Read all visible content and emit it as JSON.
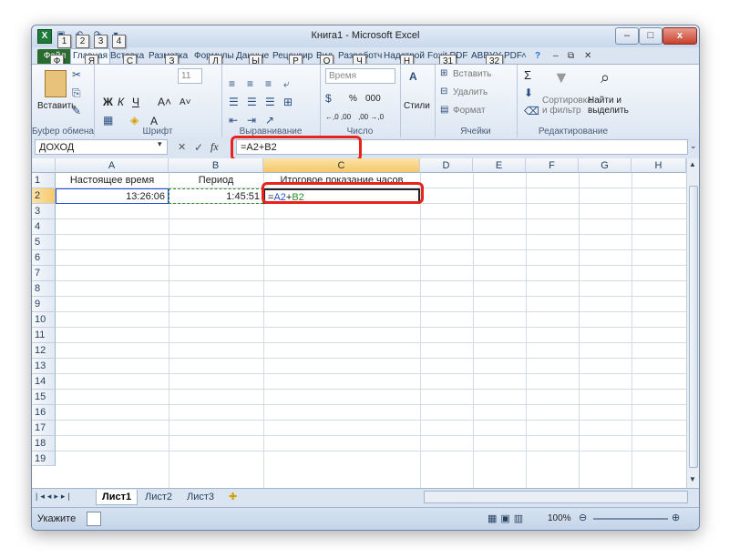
{
  "window": {
    "title": "Книга1 - Microsoft Excel",
    "app_icon": "X",
    "controls": {
      "minimize": "‒",
      "maximize": "□",
      "close": "x"
    }
  },
  "qat_keytips": [
    "1",
    "2",
    "3",
    "4"
  ],
  "tabs": [
    {
      "label": "Файл",
      "keytip": "Ф"
    },
    {
      "label": "Главная",
      "keytip": "Я"
    },
    {
      "label": "Вставка",
      "keytip": "С"
    },
    {
      "label": "Разметка",
      "keytip": "З"
    },
    {
      "label": "Формулы",
      "keytip": "Л"
    },
    {
      "label": "Данные",
      "keytip": "Ы"
    },
    {
      "label": "Рецензир",
      "keytip": "Р"
    },
    {
      "label": "Вид",
      "keytip": "О"
    },
    {
      "label": "Разработч",
      "keytip": "Ч"
    },
    {
      "label": "Надстрой",
      "keytip": "Н"
    },
    {
      "label": "Foxit PDF",
      "keytip": "31"
    },
    {
      "label": "ABBYY PDF",
      "keytip": "32"
    }
  ],
  "ribbon": {
    "clipboard": {
      "paste": "Вставить",
      "label": "Буфер обмена"
    },
    "font": {
      "size": "11",
      "bold": "Ж",
      "italic": "К",
      "underline": "Ч",
      "grow": "A˄",
      "shrink": "A˅",
      "color": "A",
      "label": "Шрифт"
    },
    "alignment": {
      "label": "Выравнивание"
    },
    "number": {
      "format": "Время",
      "percent": "%",
      "thousands": "000",
      "inc": "←,0 ,00",
      "dec": ",00 →,0",
      "label": "Число"
    },
    "styles": {
      "label": "Стили"
    },
    "cells": {
      "insert": "Вставить",
      "delete": "Удалить",
      "format": "Формат",
      "label": "Ячейки"
    },
    "editing": {
      "sum": "Σ",
      "sort": "Сортировка и фильтр",
      "find": "Найти и выделить",
      "label": "Редактирование"
    }
  },
  "formula_bar": {
    "name_box": "ДОХОД",
    "cancel": "✕",
    "enter": "✓",
    "fx": "fx",
    "formula": "=A2+B2"
  },
  "columns": [
    "A",
    "B",
    "C",
    "D",
    "E",
    "F",
    "G",
    "H"
  ],
  "rows": [
    "1",
    "2",
    "3",
    "4",
    "5",
    "6",
    "7",
    "8",
    "9",
    "10",
    "11",
    "12",
    "13",
    "14",
    "15",
    "16",
    "17",
    "18",
    "19"
  ],
  "cells": {
    "A1": "Настоящее время",
    "B1": "Период",
    "C1": "Итоговое показание часов",
    "A2": "13:26:06",
    "B2": "1:45:51",
    "C2_a": "=",
    "C2_b": "A2",
    "C2_c": "+",
    "C2_d": "B2"
  },
  "sheets": [
    "Лист1",
    "Лист2",
    "Лист3"
  ],
  "status": {
    "mode": "Укажите",
    "zoom": "100%"
  },
  "colors": {
    "highlight": "#e8231c",
    "ref_a2": "#1f4fd6",
    "ref_b2": "#2e8b2e",
    "file_tab": "#2a6b2f"
  }
}
